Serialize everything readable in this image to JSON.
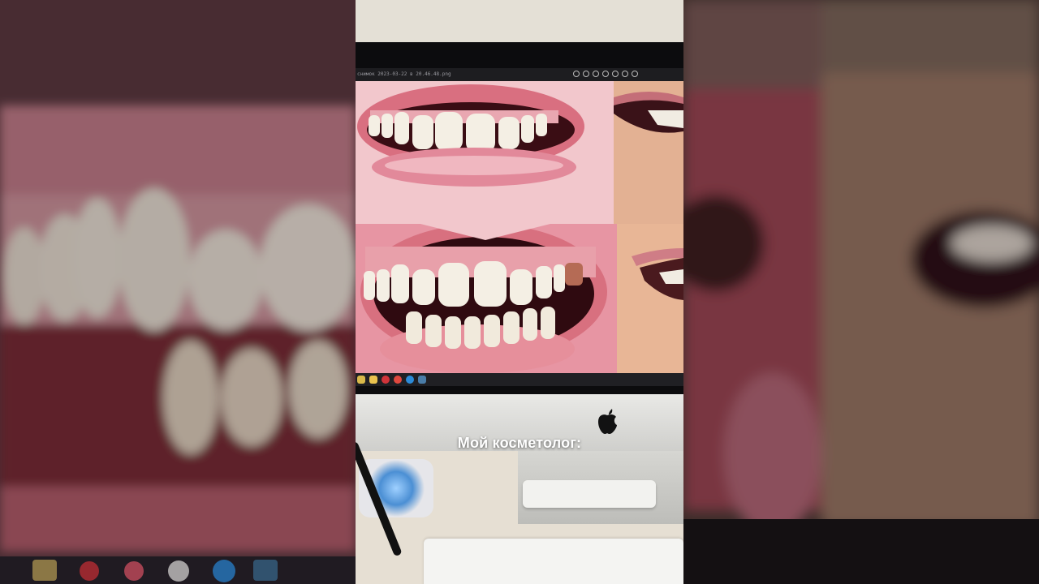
{
  "video": {
    "caption": "Мой косметолог:"
  },
  "photo_viewer": {
    "filename": "снимок 2023-03-22 в 20.46.48.png",
    "toolbar_icons": [
      "rotate-icon",
      "link-icon",
      "delete-icon",
      "heart-icon",
      "info-icon",
      "crop-icon",
      "more-icon"
    ]
  },
  "taskbar_icons": [
    "app-icon-yellow",
    "folder-icon",
    "opera-icon",
    "chrome-icon",
    "edge-icon",
    "app-icon-blue"
  ],
  "colors": {
    "lips": "#d7707e",
    "gum": "#e8a0aa",
    "teeth": "#f4efe4",
    "skin": "#e8b696",
    "mouth_dark": "#3a0d14"
  }
}
